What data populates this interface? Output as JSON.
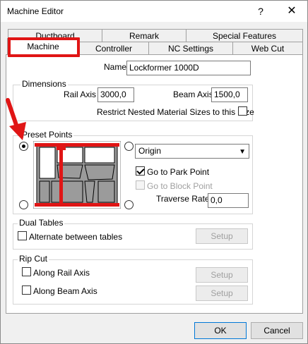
{
  "window": {
    "title": "Machine Editor",
    "help_glyph": "?",
    "close_glyph": "✕"
  },
  "tabs": {
    "row1": [
      "Ductboard",
      "Remark",
      "Special Features"
    ],
    "row2": [
      "Machine",
      "Controller",
      "NC Settings",
      "Web Cut"
    ],
    "selected": "Machine"
  },
  "name": {
    "label": "Name",
    "value": "Lockformer 1000D"
  },
  "dimensions": {
    "title": "Dimensions",
    "rail_axis_label": "Rail Axis",
    "rail_axis_value": "3000,0",
    "beam_axis_label": "Beam Axis",
    "beam_axis_value": "1500,0",
    "restrict_label": "Restrict Nested Material Sizes to this Size",
    "restrict_checked": false
  },
  "preset_points": {
    "title": "Preset Points",
    "origin_option": "Origin",
    "go_to_park_label": "Go to Park Point",
    "go_to_park_checked": true,
    "go_to_block_label": "Go to Block Point",
    "go_to_block_checked": false,
    "traverse_label": "Traverse Rate",
    "traverse_value": "0,0"
  },
  "dual_tables": {
    "title": "Dual Tables",
    "alternate_label": "Alternate between tables",
    "setup_label": "Setup"
  },
  "rip_cut": {
    "title": "Rip Cut",
    "rail_label": "Along Rail Axis",
    "beam_label": "Along Beam Axis",
    "setup_label": "Setup"
  },
  "footer": {
    "ok_label": "OK",
    "cancel_label": "Cancel"
  },
  "colors": {
    "annotation": "#e01515",
    "accent": "#0078d7"
  }
}
